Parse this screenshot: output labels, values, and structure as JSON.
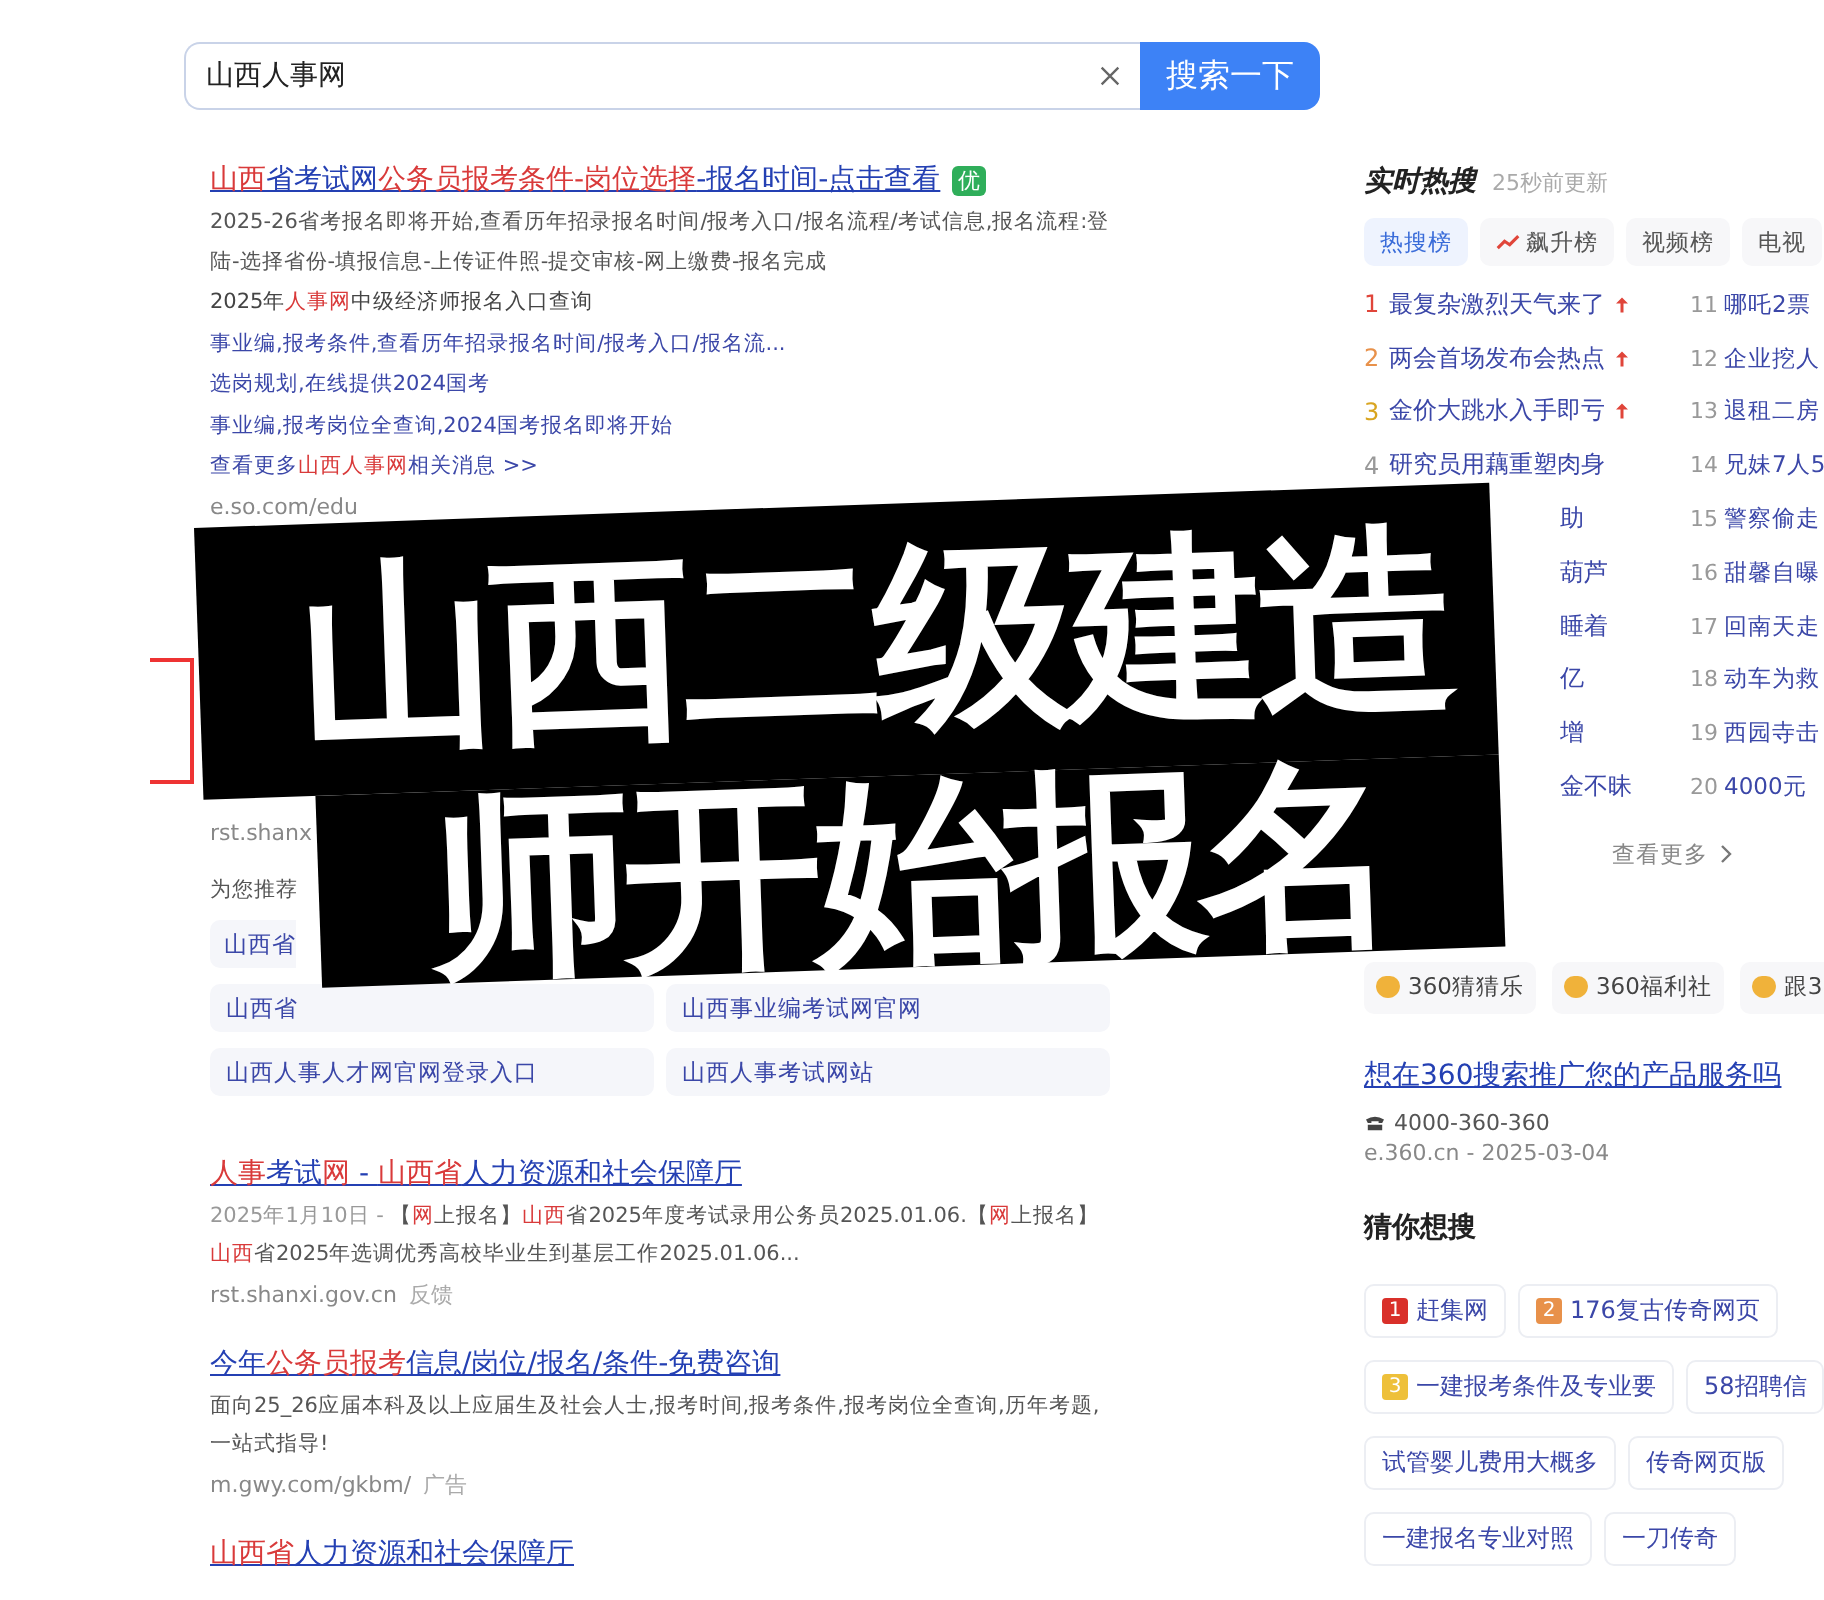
{
  "search": {
    "value": "山西人事网",
    "button": "搜索一下"
  },
  "results": [
    {
      "title": [
        {
          "text": "山西",
          "hl": true
        },
        {
          "text": "省考试网",
          "hl": false
        },
        {
          "text": "公务员报考条件-岗位选择",
          "hl": true
        },
        {
          "text": "-报名时间-点击查看",
          "hl": false
        }
      ],
      "badge": "优",
      "lines": [
        {
          "kind": "desc",
          "segments": [
            {
              "text": "2025-26省考报名即将开始,查看历年招录报名时间/报考入口/报名流程/考试信息,报名流程:登陆-选择省份-填报信息-上传证件照-提交审核-网上缴费-报名完成",
              "hl": false
            }
          ]
        },
        {
          "kind": "sub",
          "segments": [
            {
              "text": "2025年",
              "hl": false
            },
            {
              "text": "人事网",
              "hl": true
            },
            {
              "text": "中级经济师报名入口查询",
              "hl": false
            }
          ]
        },
        {
          "kind": "link",
          "segments": [
            {
              "text": "事业编,报考条件,查看历年招录报名时间/报考入口/报名流...",
              "hl": false
            }
          ]
        },
        {
          "kind": "link",
          "segments": [
            {
              "text": "选岗规划,在线提供2024国考",
              "hl": false
            }
          ]
        },
        {
          "kind": "link",
          "segments": [
            {
              "text": "事业编,报考岗位全查询,2024国考报名即将开始",
              "hl": false
            }
          ]
        },
        {
          "kind": "link",
          "segments": [
            {
              "text": "查看更多",
              "hl": false
            },
            {
              "text": "山西人事网",
              "hl": true
            },
            {
              "text": "相关消息 >>",
              "hl": false
            }
          ]
        }
      ],
      "url": "e.so.com/edu"
    },
    {
      "kind": "covered",
      "url": "rst.shanx",
      "recommend_label": "为您推荐",
      "recommend": [
        [
          "山西省"
        ],
        [
          "山西省",
          "山西事业编考试网官网"
        ],
        [
          "山西人事人才网官网登录入口",
          "山西人事考试网站"
        ]
      ]
    },
    {
      "title": [
        {
          "text": "人事",
          "hl": true
        },
        {
          "text": "考试",
          "hl": false
        },
        {
          "text": "网",
          "hl": true
        },
        {
          "text": " - ",
          "hl": false
        },
        {
          "text": "山西省",
          "hl": true
        },
        {
          "text": "人力资源和社会保障厅",
          "hl": false
        }
      ],
      "lines": [
        {
          "kind": "desc",
          "segments": [
            {
              "text": "2025年1月10日 - ",
              "hl": false,
              "muted": true
            },
            {
              "text": "【",
              "hl": false
            },
            {
              "text": "网",
              "hl": true
            },
            {
              "text": "上报名】",
              "hl": false
            },
            {
              "text": "山西",
              "hl": true
            },
            {
              "text": "省2025年度考试录用公务员2025.01.06.【",
              "hl": false
            },
            {
              "text": "网",
              "hl": true
            },
            {
              "text": "上报名】",
              "hl": false
            },
            {
              "text": "山西",
              "hl": true
            },
            {
              "text": "省2025年选调优秀高校毕业生到基层工作2025.01.06...",
              "hl": false
            }
          ]
        }
      ],
      "url": "rst.shanxi.gov.cn",
      "url_note": "反馈"
    },
    {
      "title": [
        {
          "text": "今年",
          "hl": false
        },
        {
          "text": "公务员报考",
          "hl": true
        },
        {
          "text": "信息/岗位/报名/条件-免费咨询",
          "hl": false
        }
      ],
      "lines": [
        {
          "kind": "desc",
          "segments": [
            {
              "text": "面向25_26应届本科及以上应届生及社会人士,报考时间,报考条件,报考岗位全查询,历年考题,一站式指导!",
              "hl": false
            }
          ]
        }
      ],
      "url": "m.gwy.com/gkbm/",
      "url_note": "广告"
    },
    {
      "title": [
        {
          "text": "山西省",
          "hl": true
        },
        {
          "text": "人力资源和社会保障厅",
          "hl": false
        }
      ]
    }
  ],
  "hot": {
    "title": "实时热搜",
    "updated": "25秒前更新",
    "tabs": [
      {
        "label": "热搜榜",
        "selected": true
      },
      {
        "label": "飙升榜",
        "selected": false,
        "trend": true
      },
      {
        "label": "视频榜",
        "selected": false
      },
      {
        "label": "电视",
        "selected": false
      }
    ],
    "left": [
      {
        "rank": "1",
        "text": "最复杂激烈天气来了",
        "rising": true
      },
      {
        "rank": "2",
        "text": "两会首场发布会热点",
        "rising": true
      },
      {
        "rank": "3",
        "text": "金价大跳水入手即亏",
        "rising": true
      },
      {
        "rank": "4",
        "text": "研究员用藕重塑肉身",
        "rising": false
      },
      {
        "text": "助",
        "rising": false
      },
      {
        "text": "葫芦",
        "rising": false
      },
      {
        "text": "睡着",
        "rising": false
      },
      {
        "text": "亿",
        "rising": false
      },
      {
        "text": "增",
        "rising": false
      },
      {
        "text": "金不昧",
        "rising": false
      }
    ],
    "right": [
      {
        "rank": "11",
        "text": "哪吒2票"
      },
      {
        "rank": "12",
        "text": "企业挖人"
      },
      {
        "rank": "13",
        "text": "退租二房"
      },
      {
        "rank": "14",
        "text": "兄妹7人5"
      },
      {
        "rank": "15",
        "text": "警察偷走"
      },
      {
        "rank": "16",
        "text": "甜馨自曝"
      },
      {
        "rank": "17",
        "text": "回南天走"
      },
      {
        "rank": "18",
        "text": "动车为救"
      },
      {
        "rank": "19",
        "text": "西园寺击"
      },
      {
        "rank": "20",
        "text": "4000元"
      }
    ],
    "more": "查看更多"
  },
  "apps": [
    "360猜猜乐",
    "360福利社",
    "跟3"
  ],
  "ad": {
    "title": "想在360搜索推广您的产品服务吗",
    "phone": "4000-360-360",
    "url": "e.360.cn - 2025-03-04"
  },
  "guess": {
    "title": "猜你想搜",
    "tags": [
      {
        "rank": "1",
        "color": "#d9302a",
        "text": "赶集网"
      },
      {
        "rank": "2",
        "color": "#e8914a",
        "text": "176复古传奇网页"
      },
      {
        "rank": "3",
        "color": "#eec03a",
        "text": "一建报考条件及专业要"
      },
      {
        "text": "58招聘信"
      },
      {
        "text": "试管婴儿费用大概多"
      },
      {
        "text": "传奇网页版"
      },
      {
        "text": "一建报名专业对照"
      },
      {
        "text": "一刀传奇"
      }
    ]
  },
  "banner": {
    "lines": [
      "山西二级建造",
      "师开始报名"
    ]
  }
}
